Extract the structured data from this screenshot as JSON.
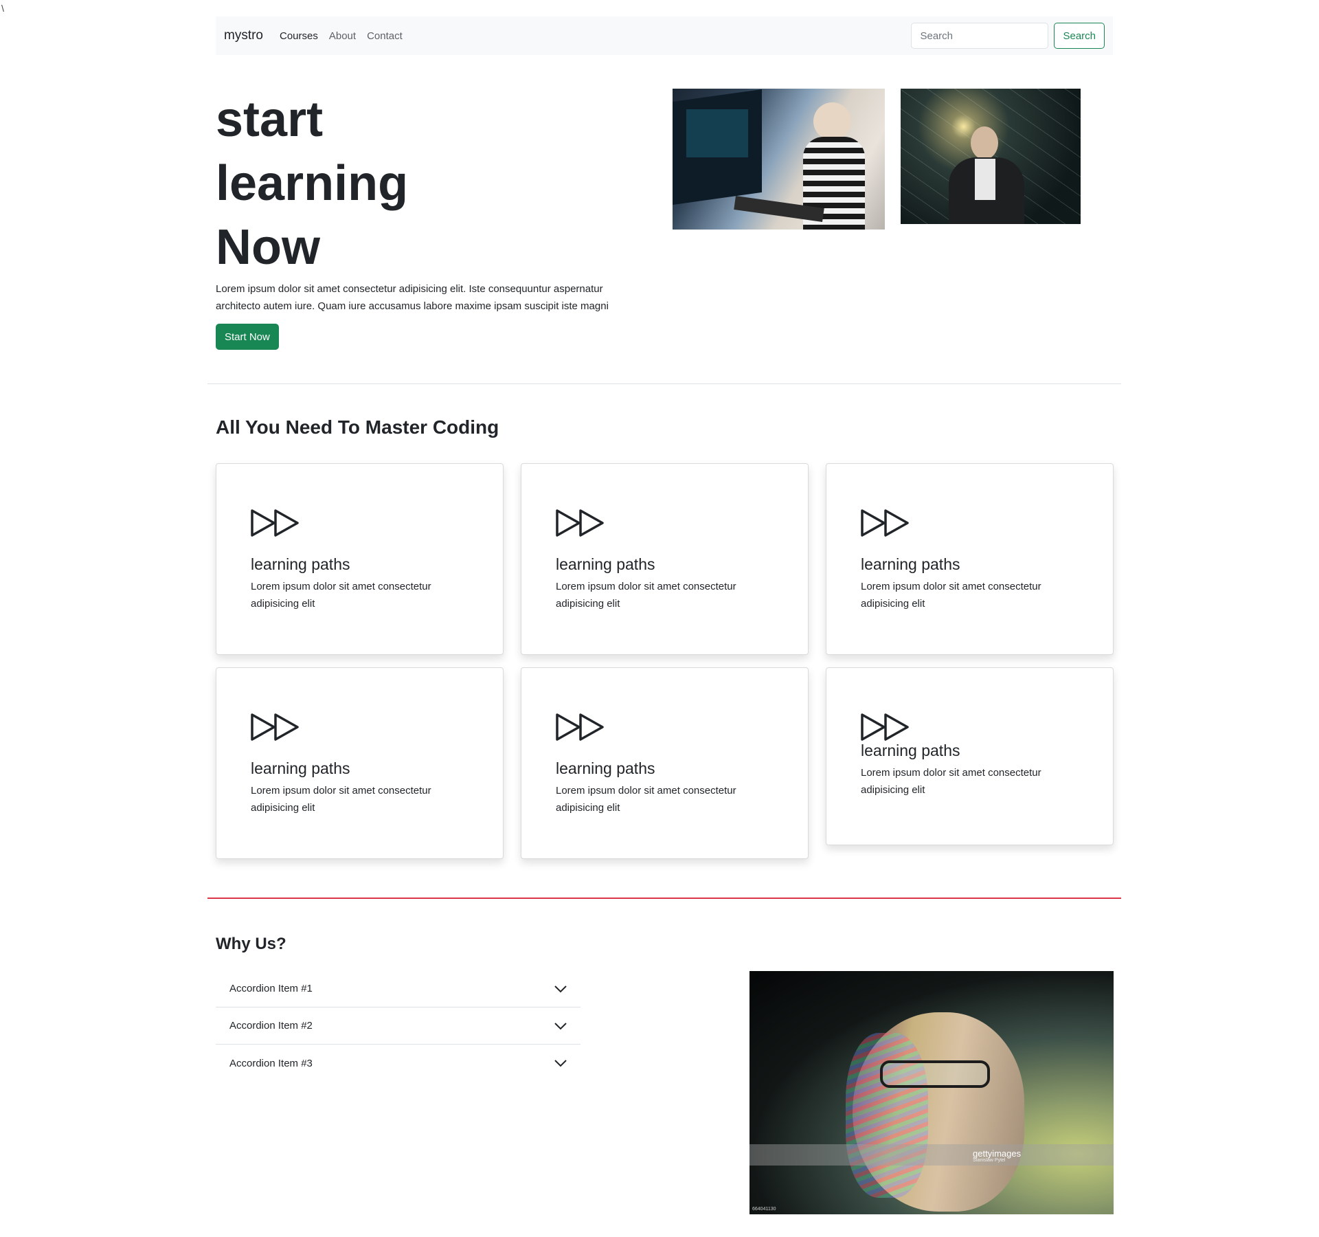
{
  "stray_char": "\\",
  "navbar": {
    "brand": "mystro",
    "links": [
      {
        "label": "Courses",
        "active": true
      },
      {
        "label": "About",
        "active": false
      },
      {
        "label": "Contact",
        "active": false
      }
    ],
    "search": {
      "placeholder": "Search",
      "button_label": "Search"
    }
  },
  "hero": {
    "title_lines": [
      "start",
      "learning",
      "Now"
    ],
    "text": "Lorem ipsum dolor sit amet consectetur adipisicing elit. Iste consequuntur aspernatur architecto autem iure. Quam iure accusamus labore maxime ipsam suscipit iste magni",
    "cta_label": "Start Now"
  },
  "features": {
    "title": "All You Need To Master Coding",
    "icon": "fast-forward-icon",
    "cards": [
      {
        "title": "learning paths",
        "text": "Lorem ipsum dolor sit amet consectetur adipisicing elit"
      },
      {
        "title": "learning paths",
        "text": "Lorem ipsum dolor sit amet consectetur adipisicing elit"
      },
      {
        "title": "learning paths",
        "text": "Lorem ipsum dolor sit amet consectetur adipisicing elit"
      },
      {
        "title": "learning paths",
        "text": "Lorem ipsum dolor sit amet consectetur adipisicing elit"
      },
      {
        "title": "learning paths",
        "text": "Lorem ipsum dolor sit amet consectetur adipisicing elit"
      },
      {
        "title": "learning paths",
        "text": "Lorem ipsum dolor sit amet consectetur adipisicing elit"
      }
    ]
  },
  "why": {
    "title": "Why Us?",
    "accordion": [
      {
        "label": "Accordion Item #1"
      },
      {
        "label": "Accordion Item #2"
      },
      {
        "label": "Accordion Item #3"
      }
    ],
    "watermark": {
      "brand": "gettyimages",
      "credit": "Stanislaw Pytel",
      "id": "664041130"
    }
  },
  "colors": {
    "primary": "#198754",
    "danger": "#dc3545",
    "navbar_bg": "#f8f9fa"
  }
}
